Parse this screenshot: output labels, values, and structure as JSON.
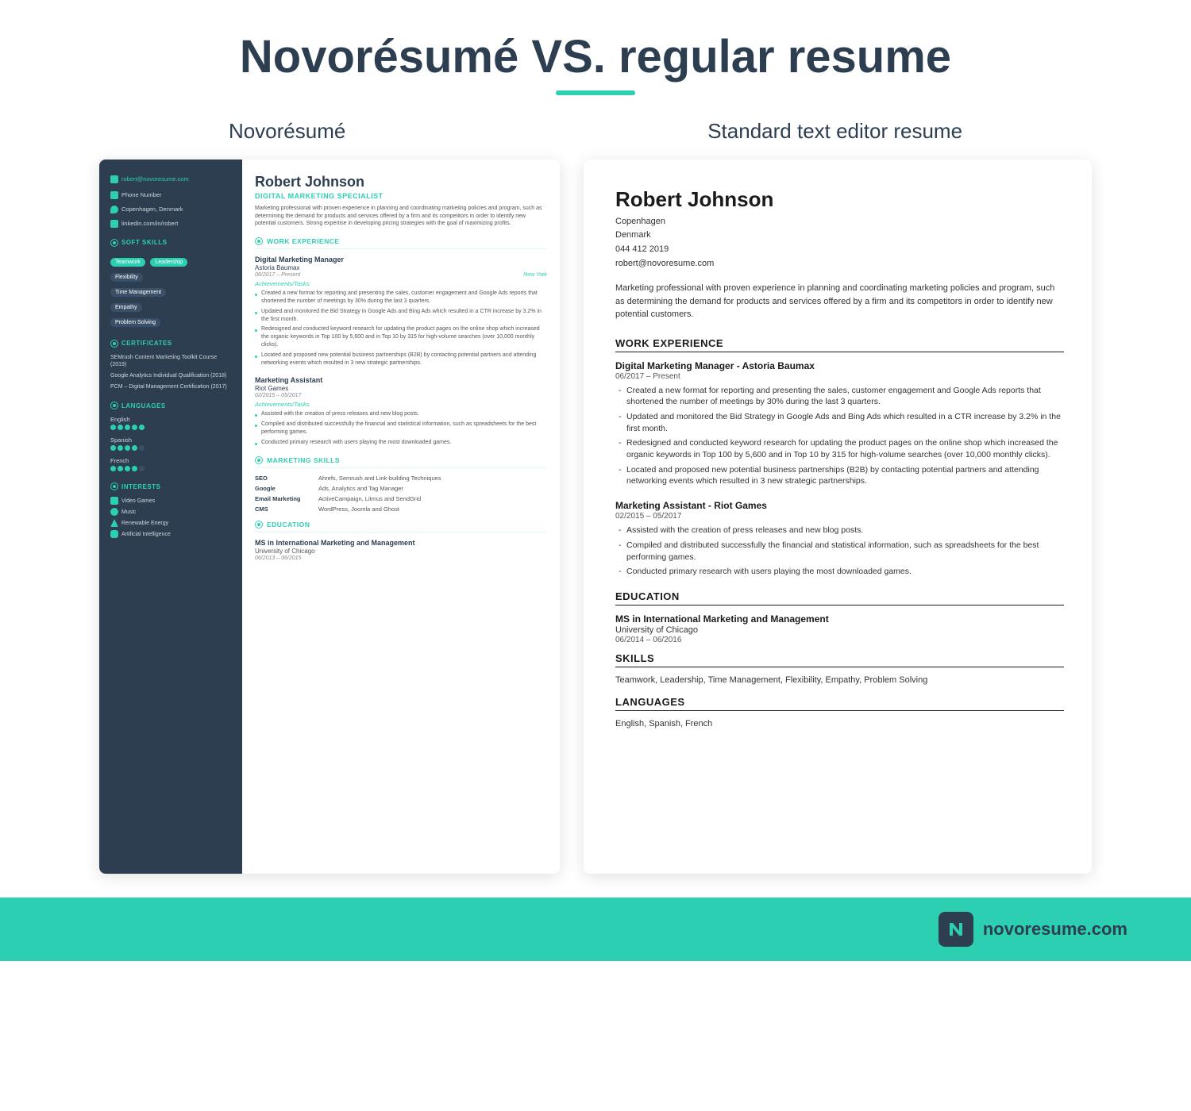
{
  "header": {
    "title": "Novorésumé VS. regular resume",
    "left_col_label": "Novorésumé",
    "right_col_label": "Standard text editor resume"
  },
  "novoresume": {
    "sidebar": {
      "email": "robert@novoresume.com",
      "phone": "Phone Number",
      "location": "Copenhagen, Denmark",
      "linkedin": "linkedin.com/in/robert",
      "soft_skills_title": "SOFT SKILLS",
      "skills": [
        "Teamwork",
        "Leadership",
        "Flexibility",
        "Time Management",
        "Empathy",
        "Problem Solving"
      ],
      "certificates_title": "CERTIFICATES",
      "certificates": [
        "SEMrush Content Marketing Toolkit Course (2019)",
        "Google Analytics Individual Qualification (2018)",
        "PCM – Digital Management Certification (2017)"
      ],
      "languages_title": "LANGUAGES",
      "languages": [
        {
          "name": "English",
          "dots": 5,
          "filled": 5
        },
        {
          "name": "Spanish",
          "dots": 5,
          "filled": 4
        },
        {
          "name": "French",
          "dots": 5,
          "filled": 4
        }
      ],
      "interests_title": "INTERESTS",
      "interests": [
        "Video Games",
        "Music",
        "Renewable Energy",
        "Artificial Intelligence"
      ]
    },
    "main": {
      "name": "Robert Johnson",
      "title": "Digital Marketing Specialist",
      "summary": "Marketing professional with proven experience in planning and coordinating marketing policies and program, such as determining the demand for products and services offered by a firm and its competitors in order to identify new potential customers. Strong expertise in developing pricing strategies with the goal of maximizing profits.",
      "work_experience_title": "WORK EXPERIENCE",
      "jobs": [
        {
          "title": "Digital Marketing Manager",
          "company": "Astoria Baumax",
          "dates": "06/2017 – Present",
          "location": "New York",
          "achievements_label": "Achievements/Tasks",
          "bullets": [
            "Created a new format for reporting and presenting the sales, customer engagement and Google Ads reports that shortened the number of meetings by 30% during the last 3 quarters.",
            "Updated and monitored the Bid Strategy in Google Ads and Bing Ads which resulted in a CTR increase by 3.2% in the first month.",
            "Redesigned and conducted keyword research for updating the product pages on the online shop which increased the organic keywords in Top 100 by 5,600 and in Top 10 by 315 for high-volume searches (over 10,000 monthly clicks).",
            "Located and proposed new potential business partnerships (B2B) by contacting potential partners and attending networking events which resulted in 3 new strategic partnerships."
          ]
        },
        {
          "title": "Marketing Assistant",
          "company": "Riot Games",
          "dates": "02/2015 – 05/2017",
          "location": "",
          "achievements_label": "Achievements/Tasks",
          "bullets": [
            "Assisted with the creation of press releases and new blog posts.",
            "Compiled and distributed successfully the financial and statistical information, such as spreadsheets for the best performing games.",
            "Conducted primary research with users playing the most downloaded games."
          ]
        }
      ],
      "marketing_skills_title": "MARKETING SKILLS",
      "skills_table": [
        {
          "key": "SEO",
          "value": "Ahrefs, Semrush and Link-building Techniques"
        },
        {
          "key": "Google",
          "value": "Ads, Analytics and Tag Manager"
        },
        {
          "key": "Email Marketing",
          "value": "ActiveCampaign, Litmus and SendGrid"
        },
        {
          "key": "CMS",
          "value": "WordPress, Joomla and Ghost"
        }
      ],
      "education_title": "EDUCATION",
      "education": [
        {
          "degree": "MS in International Marketing and Management",
          "school": "University of Chicago",
          "dates": "06/2013 – 06/2015"
        }
      ]
    }
  },
  "standard": {
    "name": "Robert Johnson",
    "contact_line1": "Copenhagen",
    "contact_line2": "Denmark",
    "contact_line3": "044 412 2019",
    "contact_line4": "robert@novoresume.com",
    "summary": "Marketing professional with proven experience in planning and coordinating marketing policies and program, such as determining the demand for products and services offered by a firm and its competitors in order to identify new potential customers.",
    "work_experience_title": "WORK EXPERIENCE",
    "jobs": [
      {
        "title": "Digital Marketing Manager - Astoria Baumax",
        "dates": "06/2017 – Present",
        "bullets": [
          "Created a new format for reporting and presenting the sales, customer engagement and Google Ads reports that shortened the number of meetings by 30% during the last 3 quarters.",
          "Updated and monitored the Bid Strategy in Google Ads and Bing Ads which resulted in a CTR increase by 3.2% in the first month.",
          "Redesigned and conducted keyword research for updating the product pages on the online shop which increased the organic keywords in Top 100 by 5,600 and in Top 10 by 315 for high-volume searches (over 10,000 monthly clicks).",
          "Located and proposed new potential business partnerships (B2B) by contacting potential partners and attending networking events which resulted in 3 new strategic partnerships."
        ]
      },
      {
        "title": "Marketing Assistant - Riot Games",
        "dates": "02/2015 – 05/2017",
        "bullets": [
          "Assisted with the creation of press releases and new blog posts.",
          "Compiled and distributed successfully the financial and statistical information, such as spreadsheets for the best performing games.",
          "Conducted primary research with users playing the most downloaded games."
        ]
      }
    ],
    "education_title": "EDUCATION",
    "education": [
      {
        "degree": "MS in International Marketing and Management",
        "school": "University of Chicago",
        "dates": "06/2014 – 06/2016"
      }
    ],
    "skills_title": "SKILLS",
    "skills_text": "Teamwork, Leadership, Time Management, Flexibility, Empathy, Problem Solving",
    "languages_title": "LANGUAGES",
    "languages_text": "English, Spanish, French"
  },
  "footer": {
    "logo_text": "novoresume.com"
  }
}
